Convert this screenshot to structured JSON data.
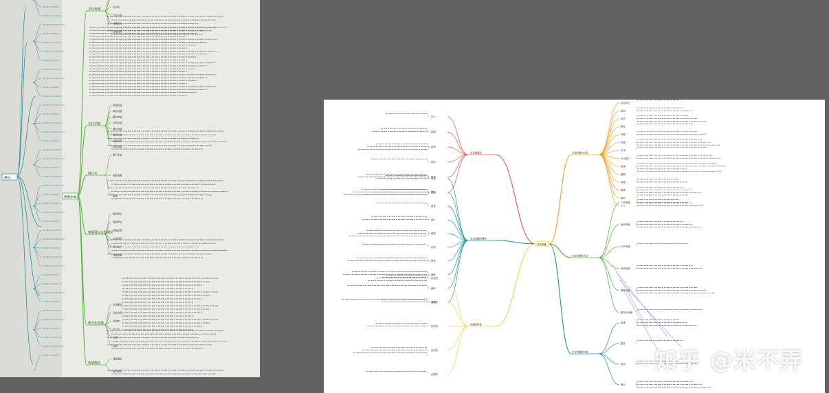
{
  "watermark": "知乎 @米不弄",
  "colors": {
    "page_background": "#626262",
    "left_canvas": "#ebebe6",
    "right_canvas": "#ffffff",
    "branch_teal": "#1e8fa5",
    "branch_green": "#4caf35",
    "branch_orange": "#f0a020",
    "branch_red": "#e05050",
    "branch_yellow": "#f0d040",
    "branch_purple": "#a4a4e6"
  },
  "left_map": {
    "root_label": "导论",
    "center_label": "简要文本",
    "branches": [
      {
        "label": "文化传播",
        "subs": [
          "基本概念",
          "历史进程",
          "大众化",
          "文化价值",
          "传播意义",
          "文化时代"
        ]
      },
      {
        "label": "文化功能",
        "subs": [
          "传递功能",
          "教化功能",
          "整合功能",
          "认同功能",
          "娱乐功能",
          "批判功能",
          "创新功能",
          "社会功能"
        ]
      },
      {
        "label": "媒介论",
        "subs": [
          "媒介形态",
          "信息传播",
          "载体"
        ]
      },
      {
        "label": "传播理论主要流派",
        "subs": [
          "批判学派",
          "经验学派",
          "传播过程",
          "文化研究",
          "意义生产",
          "传播效果"
        ]
      },
      {
        "label": "跨文化传播",
        "subs": [
          "文化差异",
          "文化冲突",
          "全球化",
          "本土化",
          "认同",
          "交流"
        ]
      },
      {
        "label": "传播模式",
        "subs": [
          "线性模式",
          "循环模式"
        ]
      }
    ]
  },
  "right_map": {
    "center_label": "文化传播",
    "branches": [
      {
        "label": "文化的概念",
        "subs": [
          "定义",
          "起源",
          "结构",
          "特征",
          "类型",
          "层次"
        ]
      },
      {
        "label": "文化传播的要素",
        "subs": [
          "传者",
          "受者",
          "信息",
          "媒介",
          "情境",
          "反馈",
          "符号",
          "编码",
          "解码",
          "语境"
        ]
      },
      {
        "label": "传播的特性",
        "subs": [
          "社会性",
          "互动性",
          "符号性",
          "目的性",
          "过程性"
        ]
      },
      {
        "label": "文化传播与社会",
        "subs": [
          "社会变迁",
          "政治",
          "经济",
          "教育",
          "宗教",
          "科技",
          "艺术",
          "大众媒介",
          "民族",
          "国家",
          "地域",
          "群体",
          "组织",
          "个人"
        ]
      },
      {
        "label": "文化传播的方式",
        "subs": [
          "人际传播",
          "组织传播",
          "大众传播",
          "网络传播",
          "群体传播",
          "跨文化传播"
        ]
      },
      {
        "label": "文化传播的功能",
        "subs": [
          "传承",
          "整合",
          "导向",
          "娱乐"
        ]
      }
    ]
  }
}
